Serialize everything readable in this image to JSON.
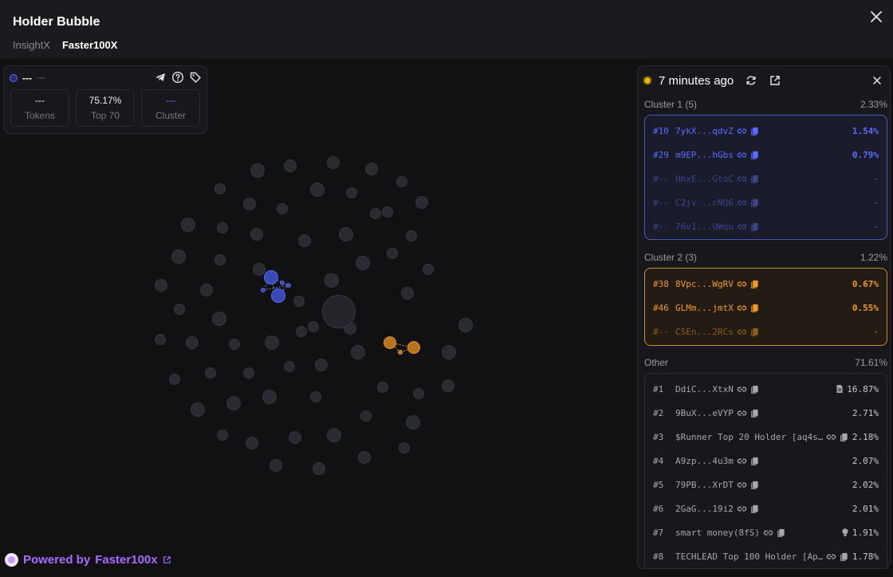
{
  "header": {
    "title": "Holder Bubble",
    "tabs": [
      {
        "label": "InsightX",
        "active": false
      },
      {
        "label": "Faster100X",
        "active": true
      }
    ]
  },
  "token_card": {
    "name": "---",
    "symbol": "---",
    "stats": [
      {
        "value": "---",
        "label": "Tokens"
      },
      {
        "value": "75.17%",
        "label": "Top 70"
      },
      {
        "value": "---",
        "label": "Cluster"
      }
    ],
    "icons": [
      "telegram-icon",
      "help-icon",
      "tag-icon"
    ]
  },
  "panel": {
    "updated": "7 minutes ago",
    "clusters": [
      {
        "title": "Cluster 1 (5)",
        "pct": "2.33%",
        "color": "#5b6bff",
        "rows": [
          {
            "rank": "#10",
            "addr": "7ykX...qdvZ",
            "pct": "1.54%"
          },
          {
            "rank": "#29",
            "addr": "m9EP...hGbs",
            "pct": "0.79%"
          },
          {
            "rank": "#--",
            "addr": "HhxE...GtoC",
            "pct": "-"
          },
          {
            "rank": "#--",
            "addr": "C2jv...cNQ6",
            "pct": "-"
          },
          {
            "rank": "#--",
            "addr": "76v1...UWqu",
            "pct": "-"
          }
        ]
      },
      {
        "title": "Cluster 2 (3)",
        "pct": "1.22%",
        "color": "#f09a24",
        "rows": [
          {
            "rank": "#38",
            "addr": "8Vpc...WgRV",
            "pct": "0.67%"
          },
          {
            "rank": "#46",
            "addr": "GLMm...jmtX",
            "pct": "0.55%"
          },
          {
            "rank": "#--",
            "addr": "CSEn...2RCs",
            "pct": "-"
          }
        ]
      }
    ],
    "other": {
      "title": "Other",
      "pct": "71.61%",
      "rows": [
        {
          "rank": "#1",
          "addr": "DdiC...XtxN",
          "pct": "16.87%",
          "lead_icon": "document-icon"
        },
        {
          "rank": "#2",
          "addr": "9BuX...eVYP",
          "pct": "2.71%"
        },
        {
          "rank": "#3",
          "addr": "$Runner Top 20 Holder [aq4s…",
          "pct": "2.18%"
        },
        {
          "rank": "#4",
          "addr": "A9zp...4u3m",
          "pct": "2.07%"
        },
        {
          "rank": "#5",
          "addr": "79PB...XrDT",
          "pct": "2.02%"
        },
        {
          "rank": "#6",
          "addr": "2GaG...19i2",
          "pct": "2.01%"
        },
        {
          "rank": "#7",
          "addr": "smart money(8fS)",
          "pct": "1.91%",
          "lead_icon": "bulb-icon"
        },
        {
          "rank": "#8",
          "addr": "TECHLEAD Top 100 Holder [Ap…",
          "pct": "1.78%"
        }
      ]
    }
  },
  "footer": {
    "powered_prefix": "Powered by",
    "brand": "Faster100x"
  },
  "colors": {
    "accent_blue": "#5b6bff",
    "accent_orange": "#f09a24",
    "accent_purple": "#a86cff",
    "live_dot": "#e5b40b"
  }
}
